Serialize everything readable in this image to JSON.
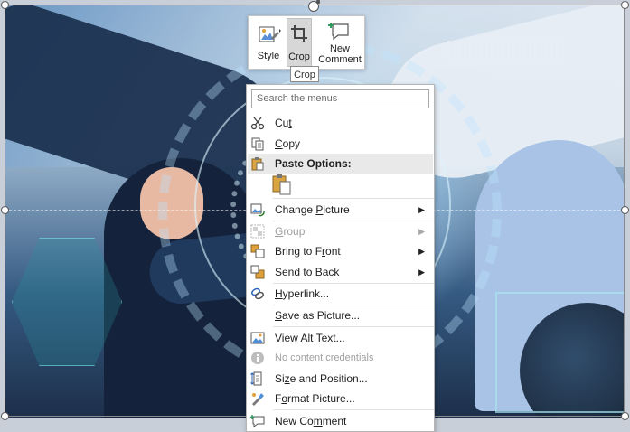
{
  "toolbar": {
    "style_label": "Style",
    "crop_label": "Crop",
    "new_comment_label": "New\nComment",
    "crop_tooltip": "Crop"
  },
  "menu": {
    "search_placeholder": "Search the menus",
    "items": [
      {
        "label_pre": "Cu",
        "label_u": "t",
        "label_post": "",
        "icon": "scissors-icon"
      },
      {
        "label_pre": "",
        "label_u": "C",
        "label_post": "opy",
        "icon": "copy-icon"
      },
      {
        "label_pre": "Paste Options:",
        "label_u": "",
        "label_post": "",
        "icon": "clipboard-icon"
      },
      {
        "label_pre": "Change ",
        "label_u": "P",
        "label_post": "icture",
        "icon": "change-picture-icon"
      },
      {
        "label_pre": "",
        "label_u": "G",
        "label_post": "roup",
        "icon": "group-icon"
      },
      {
        "label_pre": "Bring to F",
        "label_u": "r",
        "label_post": "ont",
        "icon": "bring-to-front-icon"
      },
      {
        "label_pre": "Send to Bac",
        "label_u": "k",
        "label_post": "",
        "icon": "send-to-back-icon"
      },
      {
        "label_pre": "",
        "label_u": "H",
        "label_post": "yperlink...",
        "icon": "hyperlink-icon"
      },
      {
        "label_pre": "",
        "label_u": "S",
        "label_post": "ave as Picture...",
        "icon": ""
      },
      {
        "label_pre": "View ",
        "label_u": "A",
        "label_post": "lt Text...",
        "icon": "alt-text-icon"
      },
      {
        "label_pre": "No content credentials",
        "label_u": "",
        "label_post": "",
        "icon": "info-icon"
      },
      {
        "label_pre": "Si",
        "label_u": "z",
        "label_post": "e and Position...",
        "icon": "size-position-icon"
      },
      {
        "label_pre": "F",
        "label_u": "o",
        "label_post": "rmat Picture...",
        "icon": "format-picture-icon"
      },
      {
        "label_pre": "New Co",
        "label_u": "m",
        "label_post": "ment",
        "icon": "new-comment-icon"
      }
    ],
    "submenu_arrow": "▶"
  },
  "colors": {
    "selection_border": "#8b8b8b",
    "menu_header_bg": "#e9e9e9",
    "disabled_text": "#a0a0a0"
  }
}
